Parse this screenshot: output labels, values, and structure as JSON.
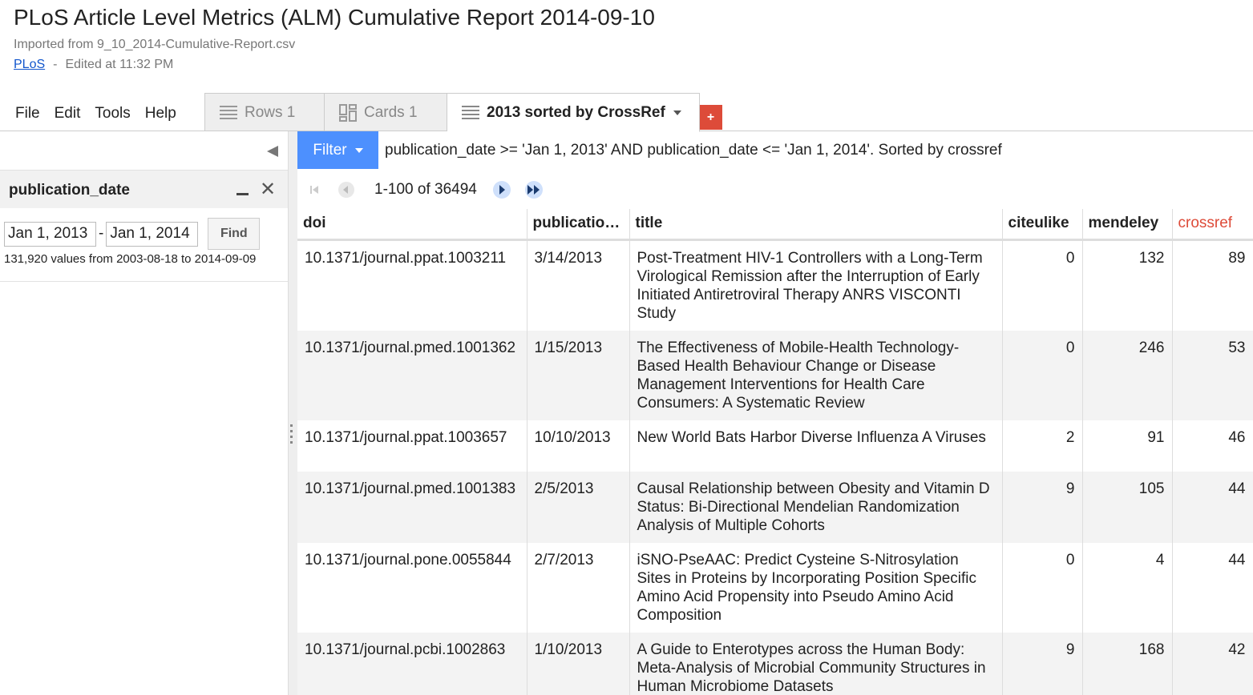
{
  "document": {
    "title": "PLoS Article Level Metrics (ALM) Cumulative Report 2014-09-10",
    "imported_from": "Imported from 9_10_2014-Cumulative-Report.csv",
    "owner": "PLoS",
    "separator": "-",
    "edited": "Edited at 11:32 PM"
  },
  "menu": [
    "File",
    "Edit",
    "Tools",
    "Help"
  ],
  "tabs": [
    {
      "label": "Rows 1",
      "icon": "rows-icon",
      "active": false
    },
    {
      "label": "Cards 1",
      "icon": "cards-icon",
      "active": false
    },
    {
      "label": "2013 sorted by CrossRef",
      "icon": "rows-icon",
      "active": true
    }
  ],
  "add_tab_label": "+",
  "facet": {
    "title": "publication_date",
    "from_value": "Jan 1, 2013",
    "to_value": "Jan 1, 2014",
    "dash": "-",
    "find_label": "Find",
    "summary": "131,920 values from 2003-08-18 to 2014-09-09"
  },
  "filter": {
    "button_label": "Filter",
    "expression": "publication_date >= 'Jan 1, 2013' AND publication_date <= 'Jan 1, 2014'. Sorted by crossref"
  },
  "pager": {
    "range_text": "1-100 of 36494"
  },
  "table": {
    "columns": [
      "doi",
      "publicatio…",
      "title",
      "citeulike",
      "mendeley",
      "crossref"
    ],
    "sorted_column": "crossref",
    "rows": [
      {
        "doi": "10.1371/journal.ppat.1003211",
        "date": "3/14/2013",
        "title": "Post-Treatment HIV-1 Controllers with a Long-Term Virological Remission after the Interruption of Early Initiated Antiretroviral Therapy ANRS VISCONTI Study",
        "citeulike": "0",
        "mendeley": "132",
        "crossref": "89"
      },
      {
        "doi": "10.1371/journal.pmed.1001362",
        "date": "1/15/2013",
        "title": "The Effectiveness of Mobile-Health Technology-Based Health Behaviour Change or Disease Management Interventions for Health Care Consumers: A Systematic Review",
        "citeulike": "0",
        "mendeley": "246",
        "crossref": "53"
      },
      {
        "doi": "10.1371/journal.ppat.1003657",
        "date": "10/10/2013",
        "title": "New World Bats Harbor Diverse Influenza A Viruses",
        "citeulike": "2",
        "mendeley": "91",
        "crossref": "46"
      },
      {
        "doi": "10.1371/journal.pmed.1001383",
        "date": "2/5/2013",
        "title": "Causal Relationship between Obesity and Vitamin D Status: Bi-Directional Mendelian Randomization Analysis of Multiple Cohorts",
        "citeulike": "9",
        "mendeley": "105",
        "crossref": "44"
      },
      {
        "doi": "10.1371/journal.pone.0055844",
        "date": "2/7/2013",
        "title": "iSNO-PseAAC: Predict Cysteine S-Nitrosylation Sites in Proteins by Incorporating Position Specific Amino Acid Propensity into Pseudo Amino Acid Composition",
        "citeulike": "0",
        "mendeley": "4",
        "crossref": "44"
      },
      {
        "doi": "10.1371/journal.pcbi.1002863",
        "date": "1/10/2013",
        "title": "A Guide to Enterotypes across the Human Body: Meta-Analysis of Microbial Community Structures in Human Microbiome Datasets",
        "citeulike": "9",
        "mendeley": "168",
        "crossref": "42"
      }
    ]
  },
  "colors": {
    "accent": "#4d90fe",
    "add_tab": "#dd4b39",
    "sorted_header": "#dd4b39",
    "link": "#1155cc"
  }
}
